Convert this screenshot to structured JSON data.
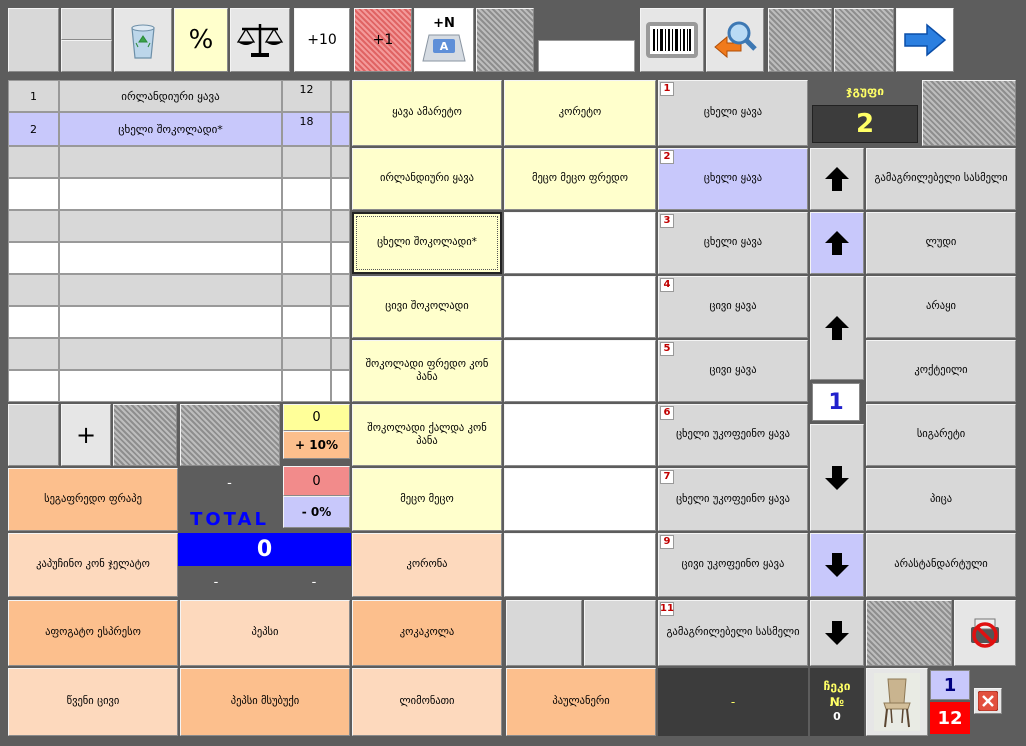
{
  "toolbar": {
    "percent_label": "%",
    "plus10_label": "+10",
    "plus1_label": "+1",
    "plusN_label": "+N",
    "keycap_letter": "A"
  },
  "order": {
    "rows": [
      {
        "no": "1",
        "name": "ირლანდიური ყავა",
        "qty": "12"
      },
      {
        "no": "2",
        "name": "ცხელი შოკოლადი*",
        "qty": "18"
      }
    ],
    "plus_label": "+"
  },
  "discounts": {
    "markup_value": "0",
    "markup_label": "+ 10%",
    "discount_value": "0",
    "discount_label": "- 0%"
  },
  "total": {
    "dash_top": "-",
    "label": "TOTAL",
    "value": "0",
    "dash_left": "-",
    "dash_right": "-"
  },
  "products": {
    "col1": [
      "ყავა ამარეტო",
      "ირლანდიური ყავა",
      "ცხელი შოკოლადი*",
      "ცივი შოკოლადი",
      "შოკოლადი ფრედო კონ პანა",
      "შოკოლადი ქალდა კონ პანა",
      "მეცო მეცო"
    ],
    "col2": [
      "კორეტო",
      "მეცო მეცო ფრედო"
    ],
    "col0_peach": [
      "სეგაფრედო ფრაპე",
      "კაპუჩინო კონ ჯელატო",
      "აფოგატო ესპრესო",
      "წვენი ცივი"
    ],
    "col_mid": [
      "პეპსი",
      "პეპსი მსუბუქი"
    ],
    "col_kor": [
      "კორონა",
      "კოკაკოლა",
      "ლიმონათი"
    ],
    "paulaner": "პაულანერი"
  },
  "groups": {
    "items": [
      {
        "n": "1",
        "label": "ცხელი ყავა"
      },
      {
        "n": "2",
        "label": "ცხელი ყავა"
      },
      {
        "n": "3",
        "label": "ცხელი ყავა"
      },
      {
        "n": "4",
        "label": "ცივი ყავა"
      },
      {
        "n": "5",
        "label": "ცივი ყავა"
      },
      {
        "n": "6",
        "label": "ცხელი უკოფეინო ყავა"
      },
      {
        "n": "7",
        "label": "ცხელი უკოფეინო ყავა"
      },
      {
        "n": "9",
        "label": "ცივი უკოფეინო ყავა"
      },
      {
        "n": "11",
        "label": "გამაგრილებელი სასმელი"
      }
    ],
    "page": "1"
  },
  "categories": [
    "გამაგრილებელი სასმელი",
    "ლუდი",
    "არაყი",
    "კოქტეილი",
    "სიგარეტი",
    "პიცა",
    "არასტანდარტული"
  ],
  "group_box": {
    "label": "ჯგუფი",
    "value": "2"
  },
  "check": {
    "label": "ჩეკი",
    "no_label": "№",
    "no_value": "0",
    "dash": "-"
  },
  "table": {
    "top": "1",
    "bottom": "12"
  },
  "colors": {
    "blue": "#0000ff",
    "yellow_text": "#ffff66",
    "red": "#ff0000"
  }
}
